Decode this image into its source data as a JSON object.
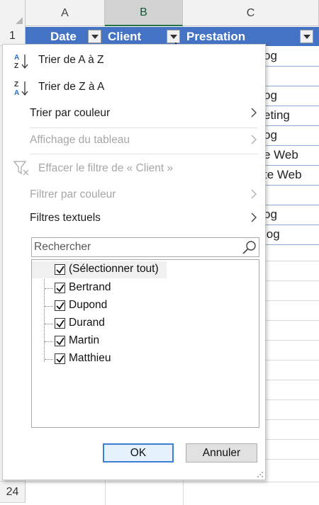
{
  "sheet": {
    "columns": [
      "A",
      "B",
      "C"
    ],
    "rows": [
      {
        "num": "1"
      },
      {
        "num": "24"
      }
    ],
    "table_header": {
      "date": "Date",
      "client": "Client",
      "prestation": "Prestation"
    },
    "visible_cell_fragments": [
      "og",
      "og",
      "eting",
      "og",
      "e Web",
      "te Web",
      "og",
      "log"
    ]
  },
  "filter_menu": {
    "sort_az": "Trier de A à Z",
    "sort_za": "Trier de Z à A",
    "sort_color": "Trier par couleur",
    "table_view": "Affichage du tableau",
    "clear_filter": "Effacer le filtre de « Client »",
    "filter_color": "Filtrer par couleur",
    "text_filters": "Filtres textuels",
    "search_placeholder": "Rechercher",
    "items": [
      {
        "label": "(Sélectionner tout)",
        "checked": true
      },
      {
        "label": "Bertrand",
        "checked": true
      },
      {
        "label": "Dupond",
        "checked": true
      },
      {
        "label": "Durand",
        "checked": true
      },
      {
        "label": "Martin",
        "checked": true
      },
      {
        "label": "Matthieu",
        "checked": true
      }
    ],
    "ok_label": "OK",
    "cancel_label": "Annuler"
  },
  "colors": {
    "table_header": "#4472c4",
    "ok_border": "#3c7fd0",
    "excel_green": "#217346"
  }
}
